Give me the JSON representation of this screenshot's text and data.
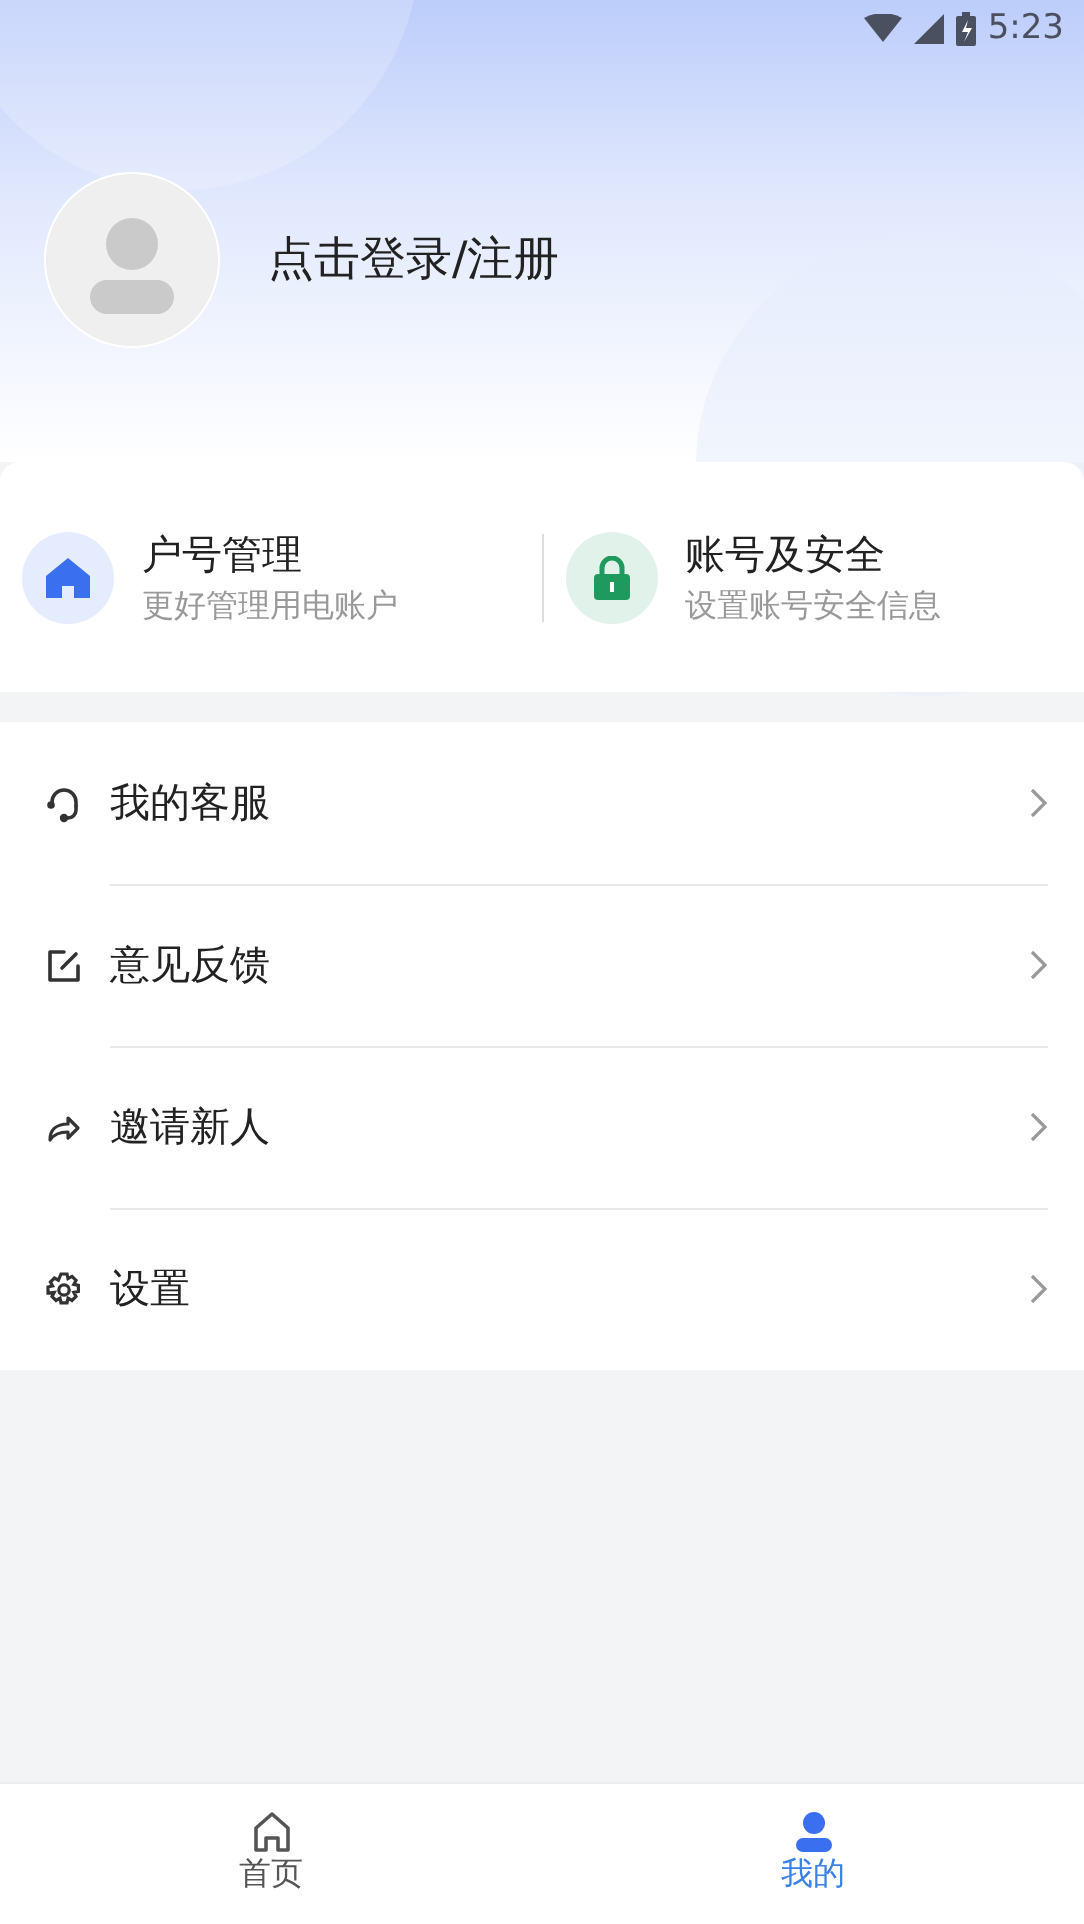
{
  "status_bar": {
    "time": "5:23"
  },
  "profile": {
    "login_prompt": "点击登录/注册"
  },
  "quick_links": [
    {
      "kind": "home",
      "title": "户号管理",
      "subtitle": "更好管理用电账户",
      "color": "#3a6ff0"
    },
    {
      "kind": "lock",
      "title": "账号及安全",
      "subtitle": "设置账号安全信息",
      "color": "#1f9a5e"
    }
  ],
  "menu": [
    {
      "kind": "headset",
      "label": "我的客服"
    },
    {
      "kind": "edit",
      "label": "意见反馈"
    },
    {
      "kind": "share",
      "label": "邀请新人"
    },
    {
      "kind": "gear",
      "label": "设置"
    }
  ],
  "tabs": [
    {
      "kind": "home",
      "label": "首页",
      "selected": false
    },
    {
      "kind": "person",
      "label": "我的",
      "selected": true
    }
  ]
}
